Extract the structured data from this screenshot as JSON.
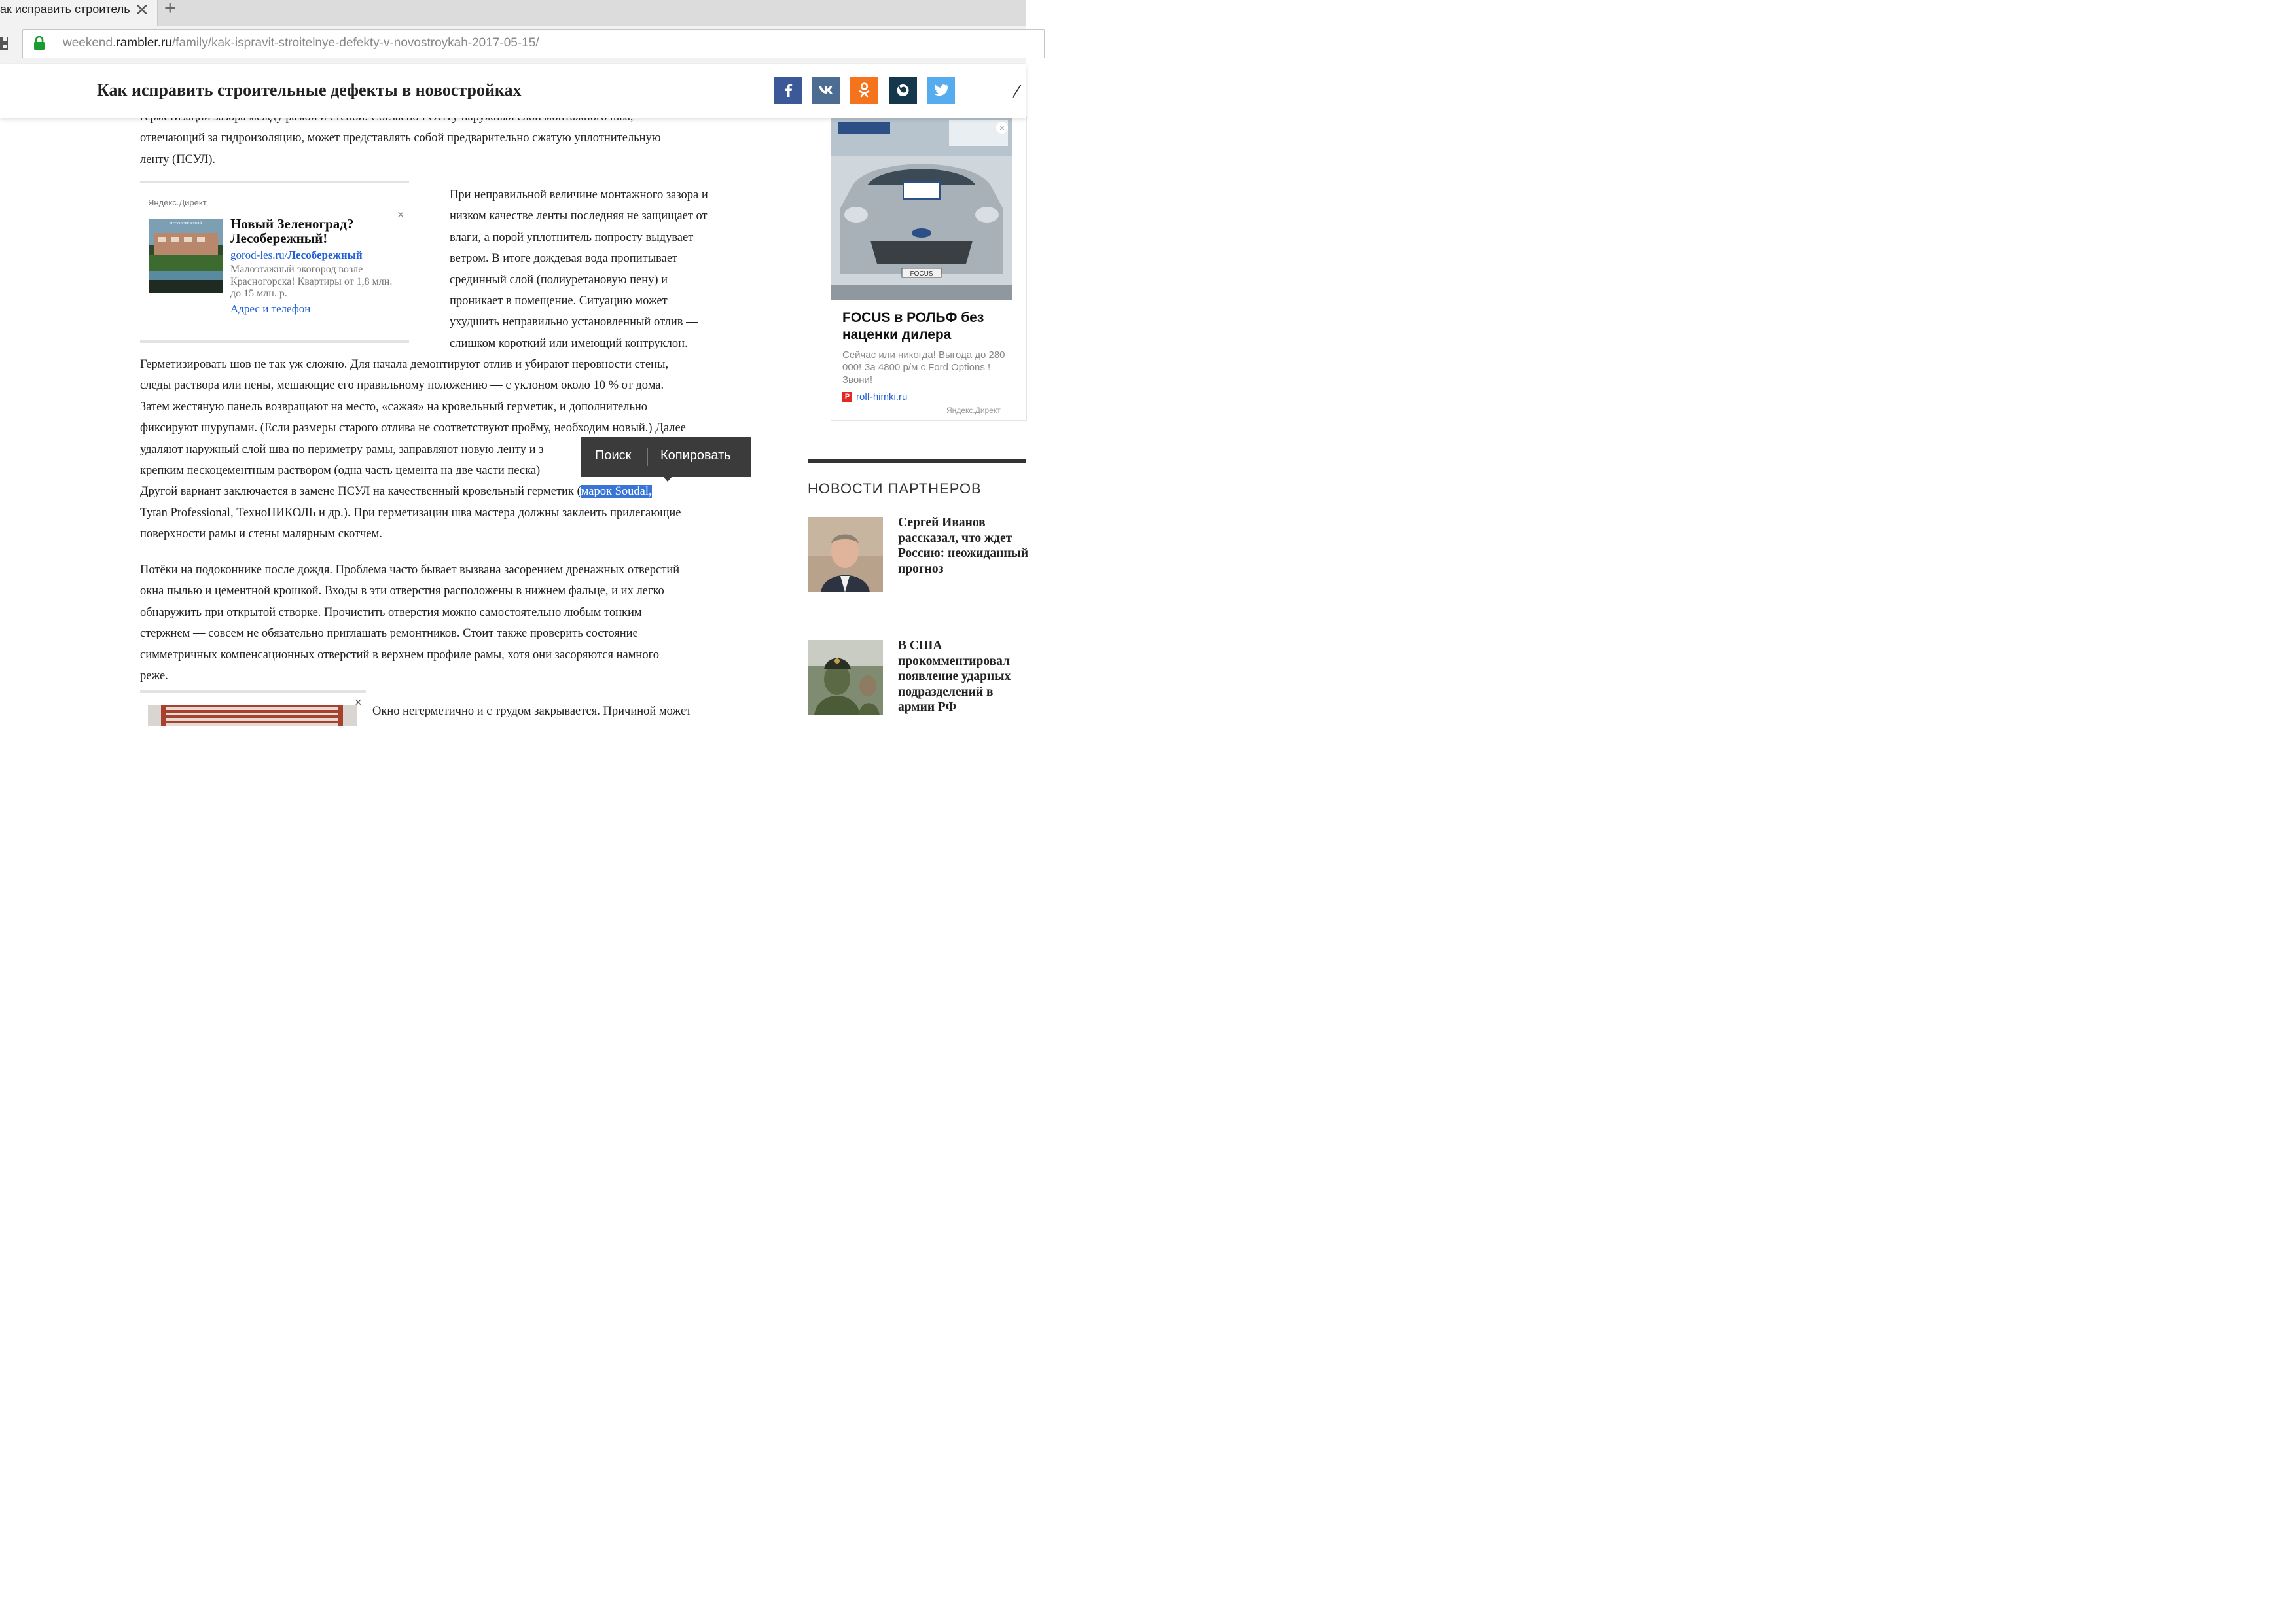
{
  "browser": {
    "tab_title": "ак исправить строитель",
    "tab_close": "✕",
    "new_tab": "+",
    "url_path_pre": "weekend.",
    "url_domain": "rambler.ru",
    "url_path": "/family/kak-ispravit-stroitelnye-defekty-v-novostroykah-2017-05-15/"
  },
  "header": {
    "title": "Как исправить строительные дефекты в новостройках",
    "share": [
      {
        "name": "facebook",
        "icon": "facebook-icon",
        "color": "#3b5998"
      },
      {
        "name": "vkontakte",
        "icon": "vk-icon",
        "color": "#4c6c91"
      },
      {
        "name": "odnoklassniki",
        "icon": "ok-icon",
        "color": "#f4731c"
      },
      {
        "name": "livejournal",
        "icon": "livejournal-icon",
        "color": "#15374c"
      },
      {
        "name": "twitter",
        "icon": "twitter-icon",
        "color": "#55acee"
      }
    ]
  },
  "article": {
    "p0": [
      "герметизации зазора между рамой и стеной. Согласно ГОСТу наружный слой монтажного шва,",
      "отвечающий за гидроизоляцию, может представлять собой предварительно сжатую уплотнительную",
      "ленту (ПСУЛ)."
    ],
    "p1": [
      "При неправильной величине монтажного зазора и",
      "низком качестве ленты последняя не защищает от",
      "влаги, а порой уплотнитель попросту выдувает",
      "ветром. В итоге дождевая вода пропитывает",
      "срединный слой (полиуретановую пену) и",
      "проникает в помещение. Ситуацию может",
      "ухудшить неправильно установленный отлив —",
      "слишком короткий или имеющий контруклон."
    ],
    "p2": [
      "Герметизировать шов не так уж сложно. Для начала демонтируют отлив и убирают неровности стены,",
      "следы раствора или пены, мешающие его правильному положению — с уклоном около 10 % от дома.",
      "Затем жестяную панель возвращают на место, «сажая» на кровельный герметик, и дополнительно",
      "фиксируют шурупами. (Если размеры старого отлива не соответствуют проёму, необходим новый.) Далее",
      "удаляют наружный слой шва по периметру рамы, заправляют новую ленту и з",
      "крепким пескоцементным раствором (одна часть цемента на две части песка)"
    ],
    "p2_line7_pre": "Другой вариант заключается в замене ПСУЛ на качественный кровельный герметик (",
    "p2_line7_sel": "марок Soudal,",
    "p2_rest": [
      "Tytan Professional, ТехноНИКОЛЬ и др.). При герметизации шва мастера должны заклеить прилегающие",
      "поверхности рамы и стены малярным скотчем."
    ],
    "p3": [
      "Потёки на подоконнике после дождя. Проблема часто бывает вызвана засорением дренажных отверстий",
      "окна пылью и цементной крошкой. Входы в эти отверстия расположены в нижнем фальце, и их легко",
      "обнаружить при открытой створке. Прочистить отверстия можно самостоятельно любым тонким",
      "стержнем — совсем не обязательно приглашать ремонтников. Стоит также проверить состояние",
      "симметричных компенсационных отверстий в верхнем профиле рамы, хотя они засоряются намного",
      "реже."
    ],
    "p4": "Окно негерметично и с трудом закрывается. Причиной может"
  },
  "ad_yandex": {
    "label": "Яндекс.Директ",
    "close": "×",
    "image_caption": "ЛЕСОБЕРЕЖНЫЙ",
    "title": "Новый Зеленоград? Лесобережный!",
    "link_domain": "gorod-les.ru/",
    "link_bold": "Лесобережный",
    "text": "Малоэтажный экогород возле Красногорска! Квартиры от 1,8 млн. до 15 млн. р.",
    "contact": "Адрес и телефон"
  },
  "context_menu": {
    "search": "Поиск",
    "copy": "Копировать"
  },
  "right_ad": {
    "title": "FOCUS в РОЛЬФ без наценки дилера",
    "text": "Сейчас или никогда! Выгода до 280 000! За 4800 р/м с Ford Options ! Звони!",
    "badge": "Р",
    "link": "rolf-himki.ru",
    "label": "Яндекс.Директ",
    "close": "×",
    "plate": "FOCUS"
  },
  "partners": {
    "heading": "НОВОСТИ ПАРТНЕРОВ",
    "items": [
      {
        "title": "Сергей Иванов рассказал, что ждет Россию: неожиданный прогноз"
      },
      {
        "title": "В США прокомментировал появление ударных подразделений в армии РФ"
      }
    ]
  },
  "ad_bottom": {
    "close": "×"
  }
}
